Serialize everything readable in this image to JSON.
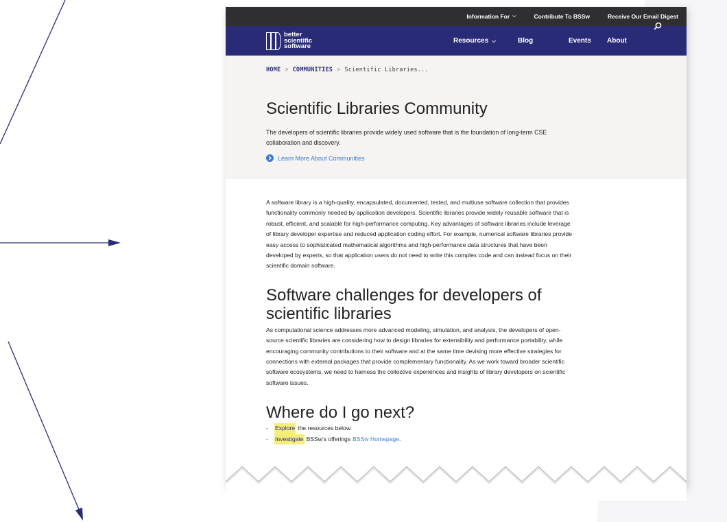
{
  "topbar": {
    "items": [
      {
        "label": "Information For",
        "has_chevron": true
      },
      {
        "label": "Contribute To BSSw",
        "has_chevron": false
      },
      {
        "label": "Receive Our Email Digest",
        "has_chevron": false
      }
    ]
  },
  "logo": {
    "line1": "better",
    "line2": "scientific",
    "line3": "software"
  },
  "nav": {
    "resources": "Resources",
    "blog": "Blog",
    "events": "Events",
    "about": "About",
    "search_icon": "search-icon"
  },
  "breadcrumb": {
    "home": "HOME",
    "communities": "COMMUNITIES",
    "current": "Scientific Libraries..."
  },
  "hero": {
    "title": "Scientific Libraries Community",
    "description": "The developers of scientific libraries provide widely used software that is the foundation of long-term CSE collaboration and discovery.",
    "link": "Learn More About Communities"
  },
  "content": {
    "intro": "A software library is a high-quality, encapsulated, documented, tested, and multiuse software collection that provides functionality commonly needed by application developers. Scientific libraries provide widely reusable software that is robust, efficient, and scalable for high-performance computing. Key advantages of software libraries include leverage of library developer expertise and reduced application coding effort. For example, numerical software libraries provide easy access to sophisticated mathematical algorithms and high-performance data structures that have been developed by experts, so that application users do not need to write this complex code and can instead focus on their scientific domain software.",
    "challenges_heading": "Software challenges for developers of scientific libraries",
    "challenges_text": "As computational science addresses more advanced modeling, simulation, and analysis, the developers of open-source scientific libraries are considering how to design libraries for extensibility and performance portability, while encouraging community contributions to their software and at the same time devising more effective strategies for connections with external packages that provide complementary functionality. As we work toward broader scientific software ecosystems, we need to harness the collective experiences and insights of library developers on scientific software issues.",
    "next_heading": "Where do I go next?",
    "next_items": [
      {
        "dash": "-",
        "highlight": "Explore",
        "text": "the resources below.",
        "link": ""
      },
      {
        "dash": "-",
        "highlight": "Investigate",
        "text": "BSSw's offerings",
        "link": "BSSw Homepage",
        "end": "."
      }
    ]
  },
  "colors": {
    "topbar": "#2f2f33",
    "nav": "#2a2b77",
    "hero_bg": "#f6f4f2",
    "link": "#3b7bd2",
    "highlight": "#f5ef7a",
    "arrow": "#2a2b77"
  }
}
